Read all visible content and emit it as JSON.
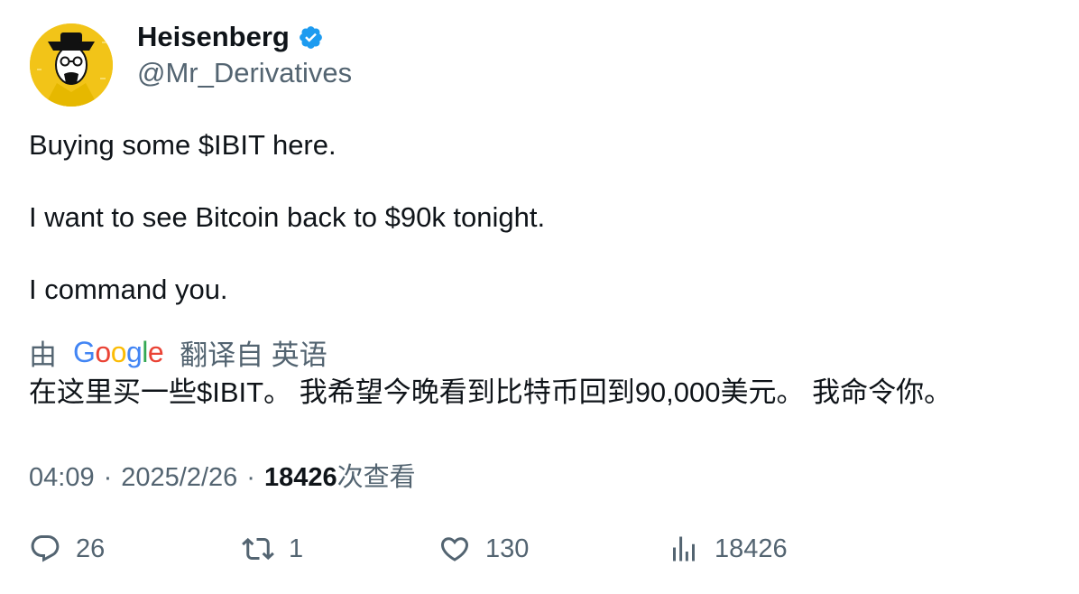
{
  "author": {
    "display_name": "Heisenberg",
    "handle": "@Mr_Derivatives",
    "verified": true,
    "verified_color": "#1d9bf0",
    "avatar_bg": "#f2c418"
  },
  "tweet": {
    "lines": [
      "Buying some $IBIT here.",
      "I want to see Bitcoin back to $90k tonight.",
      "I command you."
    ]
  },
  "translation": {
    "prefix": "由",
    "provider_letters": [
      "G",
      "o",
      "o",
      "g",
      "l",
      "e"
    ],
    "suffix": "翻译自 英语",
    "text": "在这里买一些$IBIT。 我希望今晚看到比特币回到90,000美元。 我命令你。"
  },
  "meta": {
    "time": "04:09",
    "separator": "·",
    "date": "2025/2/26",
    "views_count": "18426",
    "views_label": "次查看"
  },
  "actions": {
    "replies": "26",
    "retweets": "1",
    "likes": "130",
    "views": "18426",
    "icons": [
      "reply-icon",
      "retweet-icon",
      "like-icon",
      "views-icon"
    ]
  },
  "colors": {
    "text_primary": "#0f1419",
    "text_secondary": "#536471"
  }
}
